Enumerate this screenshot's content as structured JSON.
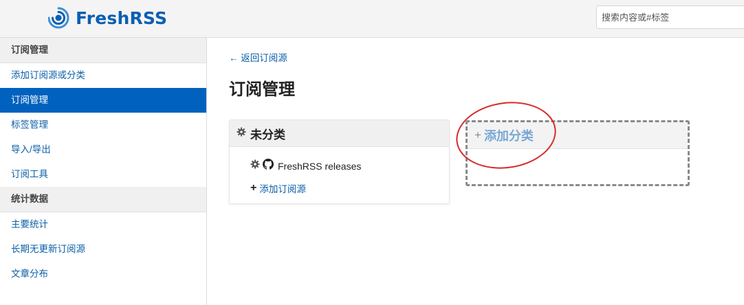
{
  "header": {
    "logo_text": "FreshRSS",
    "search": {
      "placeholder": "搜索内容或#标签",
      "value": ""
    }
  },
  "sidebar": {
    "sections": [
      {
        "heading": "订阅管理",
        "items": [
          {
            "label": "添加订阅源或分类",
            "active": false
          },
          {
            "label": "订阅管理",
            "active": true
          },
          {
            "label": "标签管理",
            "active": false
          },
          {
            "label": "导入/导出",
            "active": false
          },
          {
            "label": "订阅工具",
            "active": false
          }
        ]
      },
      {
        "heading": "统计数据",
        "items": [
          {
            "label": "主要统计",
            "active": false
          },
          {
            "label": "长期无更新订阅源",
            "active": false
          },
          {
            "label": "文章分布",
            "active": false
          }
        ]
      }
    ]
  },
  "main": {
    "back_link": "← 返回订阅源",
    "title": "订阅管理",
    "category": {
      "title": "未分类",
      "feeds": [
        {
          "name": "FreshRSS releases",
          "icon": "github-icon"
        }
      ],
      "add_feed_label": "添加订阅源"
    },
    "add_category": {
      "plus": "+",
      "label": "添加分类"
    }
  },
  "colors": {
    "brand": "#0a5fb3",
    "active_bg": "#0062be",
    "link": "#0b5fa8",
    "annotation": "#d62828"
  }
}
